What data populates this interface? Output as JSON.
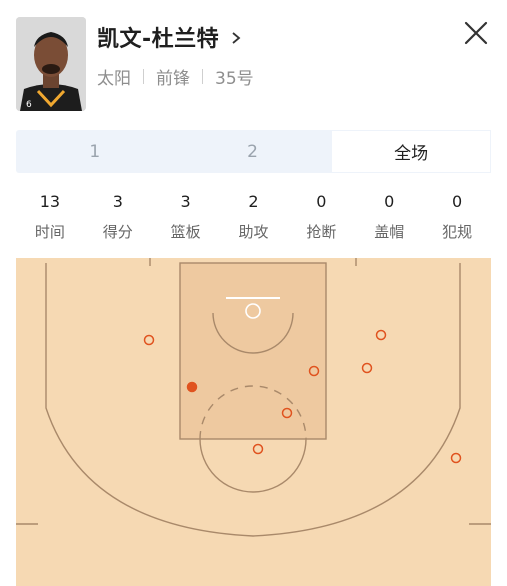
{
  "player": {
    "name": "凯文-杜兰特",
    "team": "太阳",
    "position": "前锋",
    "number": "35号",
    "jersey_badge": "6"
  },
  "tabs": [
    {
      "label": "1",
      "active": false
    },
    {
      "label": "2",
      "active": false
    },
    {
      "label": "全场",
      "active": true
    }
  ],
  "stats": [
    {
      "value": "13",
      "label": "时间"
    },
    {
      "value": "3",
      "label": "得分"
    },
    {
      "value": "3",
      "label": "篮板"
    },
    {
      "value": "2",
      "label": "助攻"
    },
    {
      "value": "0",
      "label": "抢断"
    },
    {
      "value": "0",
      "label": "盖帽"
    },
    {
      "value": "0",
      "label": "犯规"
    }
  ],
  "colors": {
    "court_floor": "#f6d9b3",
    "paint": "#eec9a0",
    "court_line": "#a9896a",
    "shot_color": "#e0531f"
  },
  "shots": [
    {
      "made": false
    },
    {
      "made": true
    },
    {
      "made": false
    },
    {
      "made": false
    },
    {
      "made": false
    },
    {
      "made": false
    },
    {
      "made": false
    },
    {
      "made": false
    }
  ]
}
